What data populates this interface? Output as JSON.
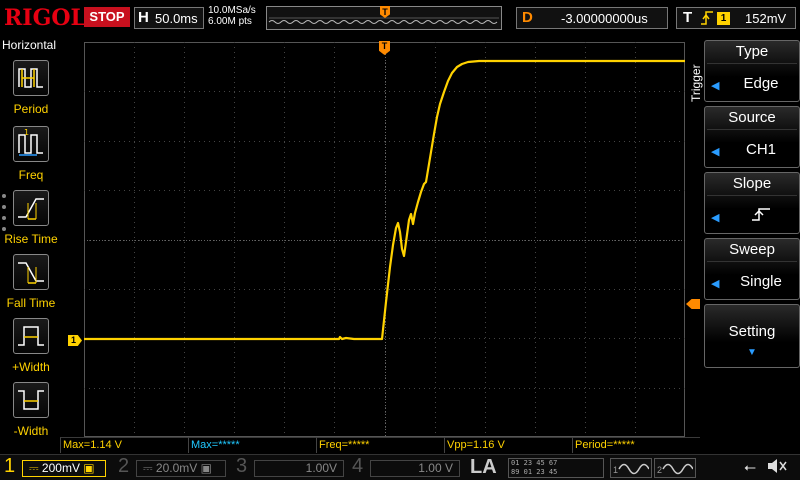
{
  "topbar": {
    "logo": "RIGOL",
    "run_status": "STOP",
    "timebase_letter": "H",
    "timebase": "50.0ms",
    "sample_rate": "10.0MSa/s",
    "memory_depth": "6.00M pts",
    "trigger_marker": "T",
    "delay_letter": "D",
    "delay": "-3.00000000us",
    "trigger_letter": "T",
    "trigger_source_badge": "1",
    "trigger_level": "152mV"
  },
  "left_panel": {
    "title": "Horizontal",
    "items": [
      {
        "label": "Period",
        "icon": "period-icon"
      },
      {
        "label": "Freq",
        "icon": "freq-icon"
      },
      {
        "label": "Rise Time",
        "icon": "rise-time-icon"
      },
      {
        "label": "Fall Time",
        "icon": "fall-time-icon"
      },
      {
        "label": "+Width",
        "icon": "pos-width-icon"
      },
      {
        "label": "-Width",
        "icon": "neg-width-icon"
      }
    ]
  },
  "trigger_menu": {
    "tab": "Trigger",
    "type_label": "Type",
    "type_value": "Edge",
    "source_label": "Source",
    "source_value": "CH1",
    "slope_label": "Slope",
    "sweep_label": "Sweep",
    "sweep_value": "Single",
    "setting_label": "Setting"
  },
  "markers": {
    "ch1_ground": "1",
    "trigger_top": "T"
  },
  "measurements": {
    "max_ch1": "Max=1.14 V",
    "max_other": "Max=*****",
    "freq": "Freq=*****",
    "vpp": "Vpp=1.16 V",
    "period": "Period=*****"
  },
  "bottom": {
    "ch1": {
      "num": "1",
      "scale": "200mV"
    },
    "ch2": {
      "num": "2",
      "scale": "20.0mV"
    },
    "ch3": {
      "num": "3",
      "scale": "1.00V"
    },
    "ch4": {
      "num": "4",
      "scale": "1.00 V"
    },
    "la": "LA",
    "la_row1": "01 23 45 67",
    "la_row2": "89 01 23 45",
    "gen1": "1",
    "gen2": "2"
  },
  "colors": {
    "ch1": "#ffd200",
    "ch2": "#20c8ff",
    "ch3": "#ff33cc",
    "ch4": "#2f7dff",
    "trigger": "#ff8a00",
    "stop": "#c8101e"
  }
}
